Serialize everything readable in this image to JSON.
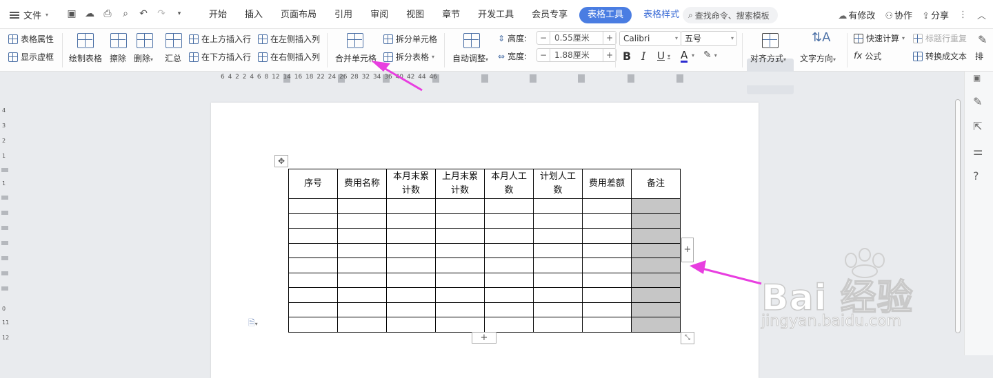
{
  "titlebar": {
    "file_menu": "文件",
    "tabs": [
      "开始",
      "插入",
      "页面布局",
      "引用",
      "审阅",
      "视图",
      "章节",
      "开发工具",
      "会员专享"
    ],
    "active_tab": "表格工具",
    "extra_tab": "表格样式",
    "search_placeholder": "查找命令、搜索模板",
    "right": {
      "changes": "有修改",
      "collab": "协作",
      "share": "分享"
    }
  },
  "ribbon": {
    "table_props": "表格属性",
    "show_gridlines": "显示虚框",
    "draw_table": "绘制表格",
    "erase": "擦除",
    "delete": "删除",
    "summary": "汇总",
    "insert_row_above": "在上方插入行",
    "insert_row_below": "在下方插入行",
    "insert_col_left": "在左侧插入列",
    "insert_col_right": "在右侧插入列",
    "merge_cells": "合并单元格",
    "split_cells": "拆分单元格",
    "split_table": "拆分表格",
    "auto_fit": "自动调整",
    "height_label": "高度:",
    "height_value": "0.55厘米",
    "width_label": "宽度:",
    "width_value": "1.88厘米",
    "font_name": "Calibri",
    "font_size": "五号",
    "alignment": "对齐方式",
    "text_direction": "文字方向",
    "quick_calc": "快速计算",
    "title_row_repeat": "标题行重复",
    "formula": "公式",
    "convert_to_text": "转换成文本",
    "more": "排"
  },
  "ruler": {
    "numbers": "6    4    2         2    4    6    8        12   14   16   18        22   24   26   28        32   34   36        40   42   44   46"
  },
  "vruler": [
    "4",
    "3",
    "2",
    "1",
    "1",
    "0",
    "11",
    "12"
  ],
  "table": {
    "headers": [
      "序号",
      "费用名称",
      "本月末累计数",
      "上月末累计数",
      "本月人工数",
      "计划人工数",
      "费用差额",
      "备注"
    ],
    "header_lines": [
      [
        "序号"
      ],
      [
        "费用名称"
      ],
      [
        "本月末累",
        "计数"
      ],
      [
        "上月末累",
        "计数"
      ],
      [
        "本月人工",
        "数"
      ],
      [
        "计划人工",
        "数"
      ],
      [
        "费用差额"
      ],
      [
        "备注"
      ]
    ],
    "empty_rows": 9,
    "selected_column": 7,
    "selection_color": "#c6c6c6"
  },
  "buttons": {
    "add_column": "+",
    "add_row": "+"
  },
  "watermark": {
    "big": "Bai 经验",
    "small": "jingyan.baidu.com"
  },
  "colors": {
    "accent": "#4a7de2",
    "arrow": "#e83ee0"
  }
}
